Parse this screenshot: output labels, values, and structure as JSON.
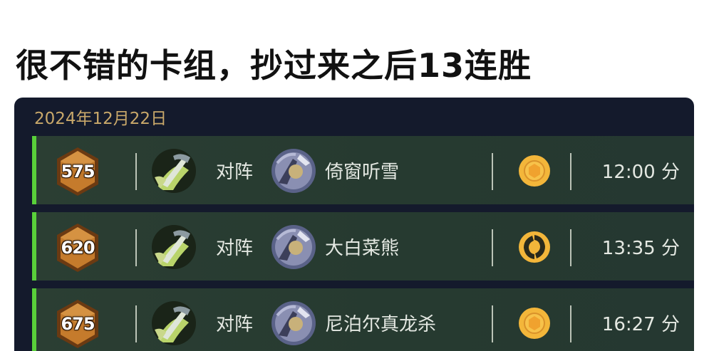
{
  "post": {
    "title": "很不错的卡组，抄过来之后13连胜"
  },
  "panel": {
    "date": "2024年12月22日"
  },
  "matches": [
    {
      "rank": "575",
      "vs_label": "对阵",
      "opponent": "倚窗听雪",
      "result_icon": "gold-coin-icon",
      "time": "12:00 分"
    },
    {
      "rank": "620",
      "vs_label": "对阵",
      "opponent": "大白菜熊",
      "result_icon": "gold-swirl-icon",
      "time": "13:35 分"
    },
    {
      "rank": "675",
      "vs_label": "对阵",
      "opponent": "尼泊尔真龙杀",
      "result_icon": "gold-coin-icon",
      "time": "16:27 分"
    }
  ],
  "colors": {
    "panel_bg": "#141a2c",
    "row_bg": "#2b3e33",
    "win_accent": "#59d03a",
    "date_text": "#c9a86a",
    "badge_gold": "#c57b2c",
    "coin_gold": "#f3b63a"
  }
}
